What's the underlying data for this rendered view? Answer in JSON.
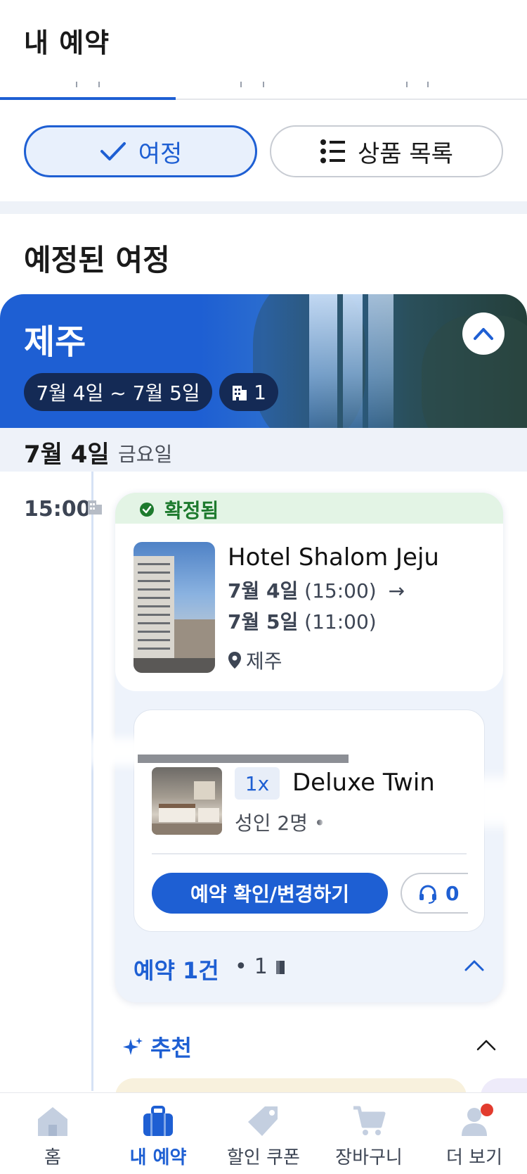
{
  "header": {
    "title": "내 예약"
  },
  "view_toggle": {
    "trip_label": "여정",
    "list_label": "상품 목록",
    "selected": "여정"
  },
  "section": {
    "title": "예정된 여정"
  },
  "trip": {
    "city": "제주",
    "date_range": "7월 4일 ~ 7월 5일",
    "count": "1",
    "day_label": "7월 4일",
    "weekday": "금요일"
  },
  "booking": {
    "time": "15:00",
    "status": "확정됨",
    "hotel_name": "Hotel Shalom Jeju",
    "checkin_date": "7월 4일",
    "checkin_time": "(15:00)",
    "arrow": "→",
    "checkout_date": "7월 5일",
    "checkout_time": "(11:00)",
    "location": "제주",
    "room": {
      "qty": "1x",
      "name": "Deluxe Twin",
      "guests": "성인 2명 •"
    },
    "manage_label": "예약 확인/변경하기",
    "support_label": "0",
    "summary_label": "예약 1건",
    "summary_sep": "•",
    "summary_count": "1"
  },
  "recommend": {
    "label": "추천"
  },
  "bottom_nav": [
    {
      "label": "홈",
      "icon": "home-icon"
    },
    {
      "label": "내 예약",
      "icon": "suitcase-icon",
      "active": true
    },
    {
      "label": "할인 쿠폰",
      "icon": "tag-icon"
    },
    {
      "label": "장바구니",
      "icon": "cart-icon"
    },
    {
      "label": "더 보기",
      "icon": "profile-icon"
    }
  ],
  "colors": {
    "accent": "#1e5fd3",
    "success": "#1d7a2d",
    "notification": "#e23b2e",
    "pill_dark": "#142a55"
  }
}
